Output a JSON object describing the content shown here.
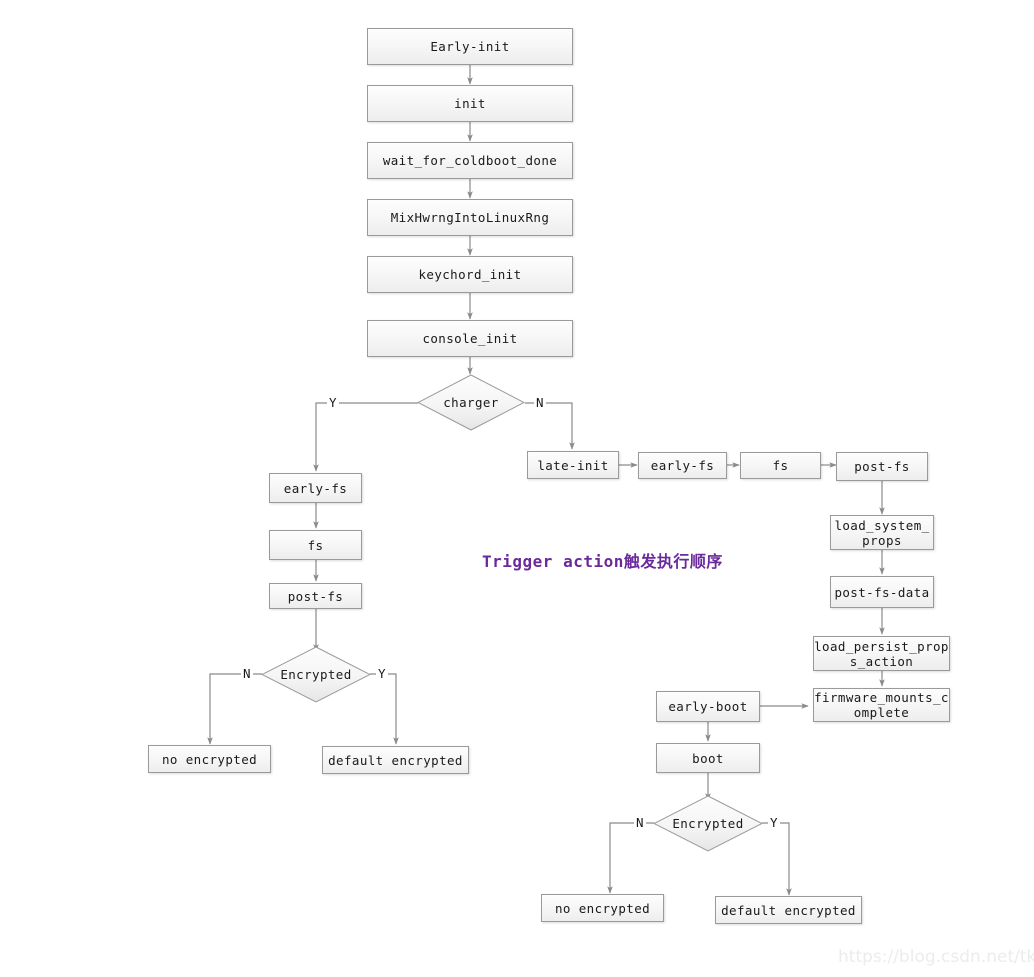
{
  "diagram": {
    "title_annotation": "Trigger action触发执行顺序",
    "watermark": "https://blog.csdn.net/tkwxty",
    "accent_color": "#6a2a9c",
    "node_border_color": "#9a9a9a",
    "edge_color": "#8a8a8a"
  },
  "nodes": {
    "early_init": "Early-init",
    "init": "init",
    "wait_for_coldboot_done": "wait_for_coldboot_done",
    "mix_hwrng": "MixHwrngIntoLinuxRng",
    "keychord_init": "keychord_init",
    "console_init": "console_init",
    "charger": "charger",
    "left_early_fs": "early-fs",
    "left_fs": "fs",
    "left_post_fs": "post-fs",
    "left_encrypted": "Encrypted",
    "left_no_encrypted": "no encrypted",
    "left_default_encrypted": "default encrypted",
    "late_init": "late-init",
    "right_early_fs": "early-fs",
    "right_fs": "fs",
    "right_post_fs": "post-fs",
    "load_system_props": "load_system_\nprops",
    "post_fs_data": "post-fs-data",
    "load_persist_props_action": "load_persist_prop\ns_action",
    "firmware_mounts_complete": "firmware_mounts_c\nomplete",
    "early_boot": "early-boot",
    "boot": "boot",
    "right_encrypted": "Encrypted",
    "right_no_encrypted": "no encrypted",
    "right_default_encrypted": "default encrypted"
  },
  "edge_labels": {
    "charger_yes": "Y",
    "charger_no": "N",
    "left_encrypted_no": "N",
    "left_encrypted_yes": "Y",
    "right_encrypted_no": "N",
    "right_encrypted_yes": "Y"
  },
  "chart_data": {
    "type": "diagram",
    "title": "Trigger action触发执行顺序",
    "shape_kinds": [
      "process-box",
      "decision-diamond"
    ],
    "edges": [
      {
        "from": "Early-init",
        "to": "init",
        "label": ""
      },
      {
        "from": "init",
        "to": "wait_for_coldboot_done",
        "label": ""
      },
      {
        "from": "wait_for_coldboot_done",
        "to": "MixHwrngIntoLinuxRng",
        "label": ""
      },
      {
        "from": "MixHwrngIntoLinuxRng",
        "to": "keychord_init",
        "label": ""
      },
      {
        "from": "keychord_init",
        "to": "console_init",
        "label": ""
      },
      {
        "from": "console_init",
        "to": "charger",
        "label": ""
      },
      {
        "from": "charger",
        "to": "early-fs (left)",
        "label": "Y"
      },
      {
        "from": "charger",
        "to": "late-init",
        "label": "N"
      },
      {
        "from": "early-fs (left)",
        "to": "fs (left)",
        "label": ""
      },
      {
        "from": "fs (left)",
        "to": "post-fs (left)",
        "label": ""
      },
      {
        "from": "post-fs (left)",
        "to": "Encrypted (left)",
        "label": ""
      },
      {
        "from": "Encrypted (left)",
        "to": "no encrypted (left)",
        "label": "N"
      },
      {
        "from": "Encrypted (left)",
        "to": "default encrypted (left)",
        "label": "Y"
      },
      {
        "from": "late-init",
        "to": "early-fs (right)",
        "label": ""
      },
      {
        "from": "early-fs (right)",
        "to": "fs (right)",
        "label": ""
      },
      {
        "from": "fs (right)",
        "to": "post-fs (right)",
        "label": ""
      },
      {
        "from": "post-fs (right)",
        "to": "load_system_props",
        "label": ""
      },
      {
        "from": "load_system_props",
        "to": "post-fs-data",
        "label": ""
      },
      {
        "from": "post-fs-data",
        "to": "load_persist_props_action",
        "label": ""
      },
      {
        "from": "load_persist_props_action",
        "to": "firmware_mounts_complete",
        "label": ""
      },
      {
        "from": "early-boot",
        "to": "firmware_mounts_complete",
        "label": ""
      },
      {
        "from": "early-boot",
        "to": "boot",
        "label": ""
      },
      {
        "from": "boot",
        "to": "Encrypted (right)",
        "label": ""
      },
      {
        "from": "Encrypted (right)",
        "to": "no encrypted (right)",
        "label": "N"
      },
      {
        "from": "Encrypted (right)",
        "to": "default encrypted (right)",
        "label": "Y"
      }
    ]
  }
}
